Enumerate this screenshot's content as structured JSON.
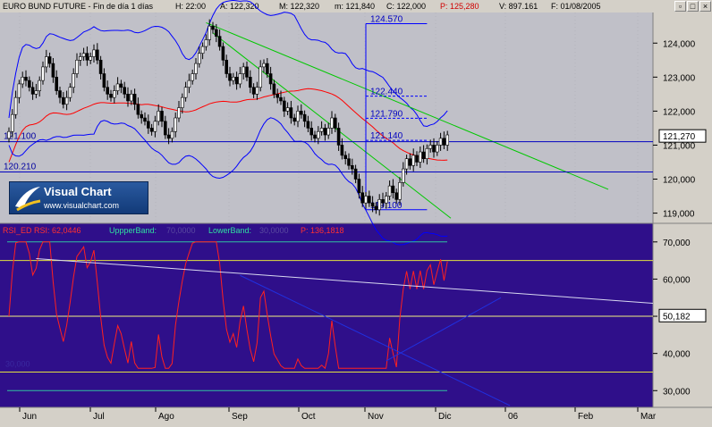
{
  "header": {
    "title": "EURO BUND FUTURE - Fin de día 1 días",
    "high": "H: 22:00",
    "ask": "A: 122,320",
    "max": "M: 122,320",
    "min": "m: 121,840",
    "close": "C: 122,000",
    "p": "P: 125,280",
    "volume": "V: 897.161",
    "date": "F: 01/08/2005"
  },
  "window_buttons": {
    "restore": "▫",
    "maximize": "□",
    "close": "×"
  },
  "logo": {
    "name": "Visual Chart",
    "url": "www.visualchart.com"
  },
  "colors": {
    "price_bg": "#c0c0c8",
    "rsi_bg": "#2f0f8a",
    "blue": "#0000ff",
    "red": "#ff0000",
    "green": "#00c800",
    "navy_band": "#0000c0"
  },
  "chart_data": [
    {
      "type": "candlestick",
      "title": "EURO BUND FUTURE",
      "ylim": [
        118.7,
        124.9
      ],
      "yticks": [
        "119,000",
        "120,000",
        "121,000",
        "122,000",
        "123,000",
        "124,000"
      ],
      "current_price": "121,270",
      "months": [
        "Jun",
        "Jul",
        "Ago",
        "Sep",
        "Oct",
        "Nov",
        "Dic",
        "06",
        "Feb",
        "Mar"
      ],
      "close": [
        121.4,
        121.9,
        122.4,
        122.8,
        123.0,
        122.9,
        122.7,
        122.5,
        122.6,
        122.9,
        123.3,
        123.6,
        123.4,
        123.0,
        122.6,
        122.4,
        122.2,
        122.4,
        122.7,
        123.1,
        123.5,
        123.6,
        123.7,
        123.5,
        123.6,
        123.8,
        123.5,
        123.1,
        122.7,
        122.5,
        122.4,
        122.6,
        122.8,
        122.7,
        122.5,
        122.3,
        122.5,
        122.2,
        121.9,
        121.8,
        121.7,
        121.5,
        121.4,
        121.7,
        122.0,
        121.7,
        121.3,
        121.2,
        121.4,
        121.8,
        122.1,
        122.4,
        122.7,
        122.9,
        123.1,
        123.4,
        123.7,
        123.9,
        124.1,
        124.5,
        124.4,
        124.2,
        123.9,
        123.5,
        123.1,
        122.9,
        123.0,
        122.8,
        123.1,
        123.3,
        123.0,
        122.7,
        122.5,
        122.7,
        123.3,
        123.4,
        123.1,
        122.8,
        122.5,
        122.4,
        122.3,
        122.0,
        122.1,
        121.8,
        121.7,
        122.0,
        121.9,
        121.7,
        121.5,
        121.3,
        121.2,
        121.4,
        121.5,
        121.3,
        121.5,
        121.8,
        121.5,
        121.0,
        120.7,
        120.6,
        120.4,
        120.3,
        120.0,
        119.6,
        119.3,
        119.5,
        119.3,
        119.2,
        119.1,
        119.4,
        119.3,
        119.5,
        119.8,
        119.6,
        119.4,
        119.9,
        120.3,
        120.6,
        120.4,
        120.7,
        120.5,
        120.8,
        120.6,
        120.9,
        121.0,
        120.8,
        121.0,
        121.2,
        121.0,
        121.3
      ],
      "annotations": {
        "hlines": [
          {
            "value": 121.1,
            "label": "121.100"
          },
          {
            "value": 120.21,
            "label": "120.210"
          }
        ],
        "fib_levels": [
          {
            "value": 124.57,
            "label": "124.570"
          },
          {
            "value": 122.44,
            "label": "122.440"
          },
          {
            "value": 121.79,
            "label": "121.790"
          },
          {
            "value": 121.14,
            "label": "121.140"
          },
          {
            "value": 119.1,
            "label": "119.100"
          }
        ]
      }
    },
    {
      "type": "line",
      "indicator": "RSI_ED",
      "legend": {
        "rsi": "RSI_ED  RSI: 62,0446",
        "upper": "UppperBand:",
        "upper_val": "70,0000",
        "lower": "LowerBand:",
        "lower_val": "30,0000",
        "p": "P: 136,1818"
      },
      "ylim": [
        25.5,
        75
      ],
      "yticks": [
        "70,000",
        "60,000",
        "50,000",
        "40,000",
        "30,000"
      ],
      "current_value": "50,182",
      "left_label": "30,000",
      "bands": [
        70,
        65,
        50,
        35,
        30
      ]
    }
  ]
}
